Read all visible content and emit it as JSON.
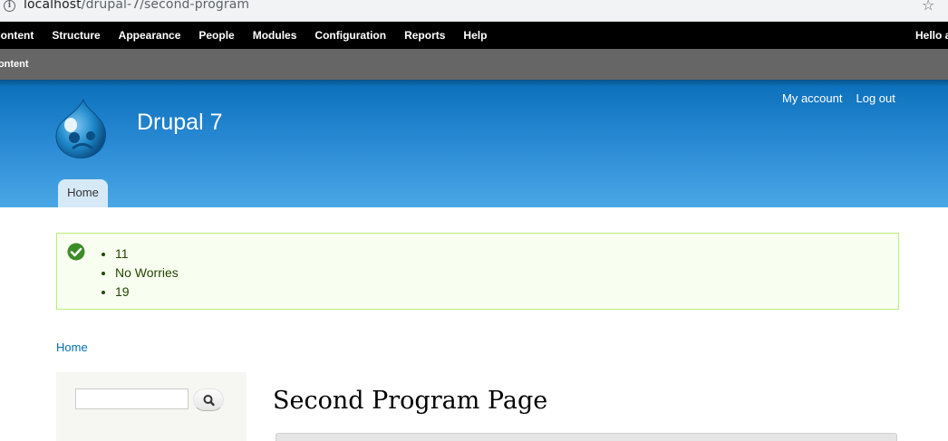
{
  "browser": {
    "url_host": "localhost",
    "url_path": "/drupal-7/second-program"
  },
  "toolbar": {
    "items": [
      {
        "label": "Content"
      },
      {
        "label": "Structure"
      },
      {
        "label": "Appearance"
      },
      {
        "label": "People"
      },
      {
        "label": "Modules"
      },
      {
        "label": "Configuration"
      },
      {
        "label": "Reports"
      },
      {
        "label": "Help"
      }
    ],
    "greeting": "Hello a"
  },
  "shortcuts": {
    "item": "Content"
  },
  "header": {
    "site_name": "Drupal 7",
    "secondary_menu": [
      {
        "label": "My account"
      },
      {
        "label": "Log out"
      }
    ],
    "main_menu": [
      {
        "label": "Home"
      }
    ]
  },
  "messages": {
    "type": "status",
    "items": [
      "11",
      "No Worries",
      "19"
    ]
  },
  "breadcrumb": {
    "items": [
      "Home"
    ]
  },
  "sidebar": {
    "search": {
      "value": "",
      "placeholder": ""
    }
  },
  "main": {
    "title": "Second Program Page"
  },
  "colors": {
    "toolbar_bg": "#000000",
    "shortcuts_bg": "#666666",
    "header_top": "#0a6fbb",
    "header_bottom": "#4aa7e5",
    "message_bg": "#f8fff0",
    "message_border": "#bbee77",
    "link": "#0071b3"
  }
}
